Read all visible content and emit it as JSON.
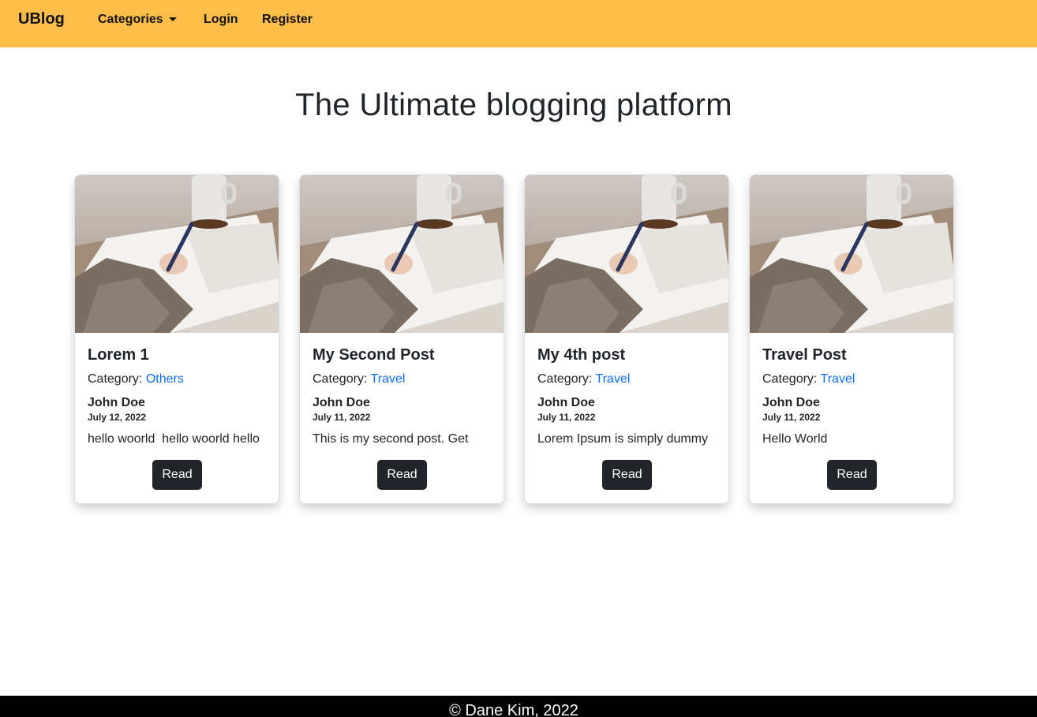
{
  "navbar": {
    "brand": "UBlog",
    "items": [
      {
        "label": "Categories",
        "dropdown": true
      },
      {
        "label": "Login"
      },
      {
        "label": "Register"
      }
    ],
    "background_color": "#ffbe4a"
  },
  "main": {
    "title": "The Ultimate blogging platform"
  },
  "posts": [
    {
      "title": "Lorem 1",
      "category_label": "Category: ",
      "category": "Others",
      "author": "John Doe",
      "date": "July 12, 2022",
      "excerpt": "hello woorld  hello woorld hello",
      "button_label": "Read",
      "image": "person-writing-notebook-photo"
    },
    {
      "title": "My Second Post",
      "category_label": "Category: ",
      "category": "Travel",
      "author": "John Doe",
      "date": "July 11, 2022",
      "excerpt": "This is my second post. Get",
      "button_label": "Read",
      "image": "person-writing-notebook-photo"
    },
    {
      "title": "My 4th post",
      "category_label": "Category: ",
      "category": "Travel",
      "author": "John Doe",
      "date": "July 11, 2022",
      "excerpt": "Lorem Ipsum is simply dummy",
      "button_label": "Read",
      "image": "person-writing-notebook-photo"
    },
    {
      "title": "Travel Post",
      "category_label": "Category: ",
      "category": "Travel",
      "author": "John Doe",
      "date": "July 11, 2022",
      "excerpt": "Hello World",
      "button_label": "Read",
      "image": "person-writing-notebook-photo"
    }
  ],
  "footer": {
    "text": "© Dane Kim, 2022"
  },
  "colors": {
    "accent": "#ffbe4a",
    "link": "#0d6efd",
    "button": "#212529",
    "footer": "#000000"
  }
}
